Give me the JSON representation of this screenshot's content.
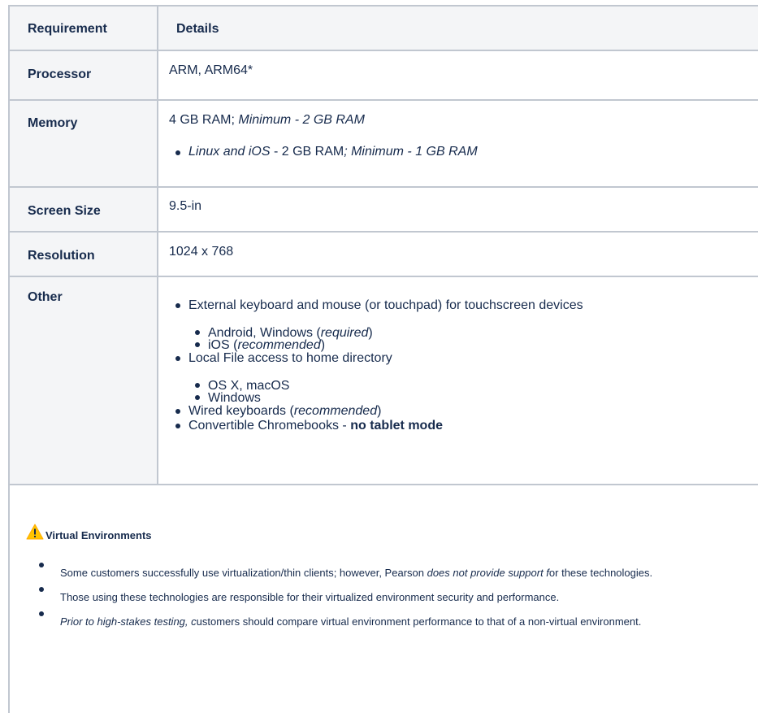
{
  "table": {
    "headers": [
      "Requirement",
      "Details"
    ],
    "processor": {
      "label": "Processor",
      "value": "ARM, ARM64*"
    },
    "memory": {
      "label": "Memory",
      "main_plain": "4 GB RAM; ",
      "main_italic": "Minimum - 2 GB RAM",
      "sub_italic_a": "Linux and iOS",
      "sub_plain": " - 2 GB RAM",
      "sub_italic_b": "; Minimum - 1 GB RAM"
    },
    "screen": {
      "label": "Screen Size",
      "value": "9.5-in"
    },
    "resolution": {
      "label": "Resolution",
      "value": "1024 x 768"
    },
    "other": {
      "label": "Other",
      "item1": "External keyboard and mouse (or touchpad) for touchscreen devices",
      "item1_sub1_plain": "Android, Windows (",
      "item1_sub1_italic": "required",
      "item1_sub1_close": ")",
      "item1_sub2_plain": "iOS (",
      "item1_sub2_italic": "recommended",
      "item1_sub2_close": ")",
      "item2": "Local File access to home directory",
      "item2_sub1": "OS X, macOS",
      "item2_sub2": "Windows",
      "item3_plain": "Wired keyboards (",
      "item3_italic": "recommended",
      "item3_close": ")",
      "item4_plain": "Convertible Chromebooks - ",
      "item4_bold": "no tablet mode"
    }
  },
  "virtual": {
    "title": "Virtual Environments",
    "icon": "warning-icon",
    "icon_color": "#ffc400",
    "b1_plain": "Some customers successfully use virtualization/thin clients; however, Pearson ",
    "b1_italic": "does not provide support f",
    "b1_tail": "or these technologies.",
    "b2": "Those using these technologies are responsible for their virtualized environment security and performance.",
    "b3_italic": "Prior to high-stakes testing, c",
    "b3_tail": "ustomers should compare virtual environment performance to that of a non-virtual environment."
  }
}
